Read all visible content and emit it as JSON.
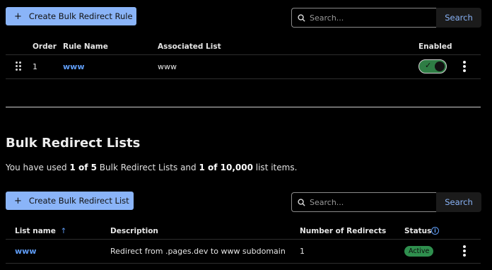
{
  "rules": {
    "create_button": "Create Bulk Redirect Rule",
    "search": {
      "placeholder": "Search...",
      "button": "Search"
    },
    "columns": {
      "order": "Order",
      "rule_name": "Rule Name",
      "associated_list": "Associated List",
      "enabled": "Enabled"
    },
    "rows": [
      {
        "order": "1",
        "rule_name": "www",
        "associated_list": "www",
        "enabled": true
      }
    ]
  },
  "lists": {
    "title": "Bulk Redirect Lists",
    "usage": {
      "prefix": "You have used ",
      "lists_used": "1 of 5",
      "middle": " Bulk Redirect Lists and ",
      "items_used": "1 of 10,000",
      "suffix": " list items."
    },
    "create_button": "Create Bulk Redirect List",
    "search": {
      "placeholder": "Search...",
      "button": "Search"
    },
    "columns": {
      "list_name": "List name",
      "sort_arrow": "↑",
      "description": "Description",
      "redirects": "Number of Redirects",
      "status": "Status"
    },
    "rows": [
      {
        "list_name": "www",
        "description": "Redirect from .pages.dev to www subdomain",
        "redirects": "1",
        "status": "Active"
      }
    ]
  },
  "colors": {
    "accent": "#8ab4f8",
    "link": "#5f9cf5",
    "toggle_on": "#2e7d44",
    "status_active": "#2f8f4e"
  }
}
